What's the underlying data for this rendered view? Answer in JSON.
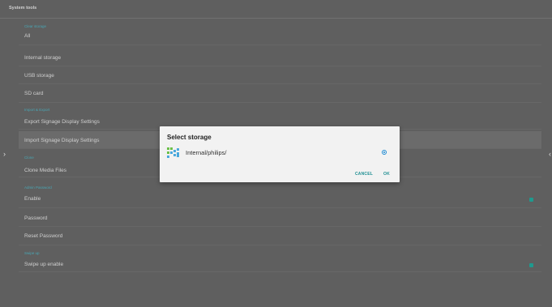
{
  "header": {
    "title": "System tools"
  },
  "sections": {
    "clear_storage": "Clear storage",
    "import_export": "Import & Export",
    "clone": "Clone",
    "admin_password": "Admin Password",
    "swipe_up": "Swipe up"
  },
  "rows": {
    "all": "All",
    "internal_storage": "Internal storage",
    "usb_storage": "USB storage",
    "sd_card": "SD card",
    "export_settings": "Export Signage Display Settings",
    "import_settings": "Import Signage Display Settings",
    "clone_media": "Clone Media Files",
    "enable": "Enable",
    "password": "Password",
    "reset_password": "Reset Password",
    "swipe_up_enable": "Swipe up enable"
  },
  "checkbox_states": {
    "enable": true,
    "swipe_up_enable": true
  },
  "nav": {
    "left": "›",
    "right": "‹"
  },
  "dialog": {
    "title": "Select storage",
    "option": "Internal/philips/",
    "option_selected": true,
    "cancel": "CANCEL",
    "ok": "OK"
  },
  "colors": {
    "accent": "#1f9a8e",
    "section_label": "#49a6b4",
    "radio": "#1e8bd4"
  }
}
